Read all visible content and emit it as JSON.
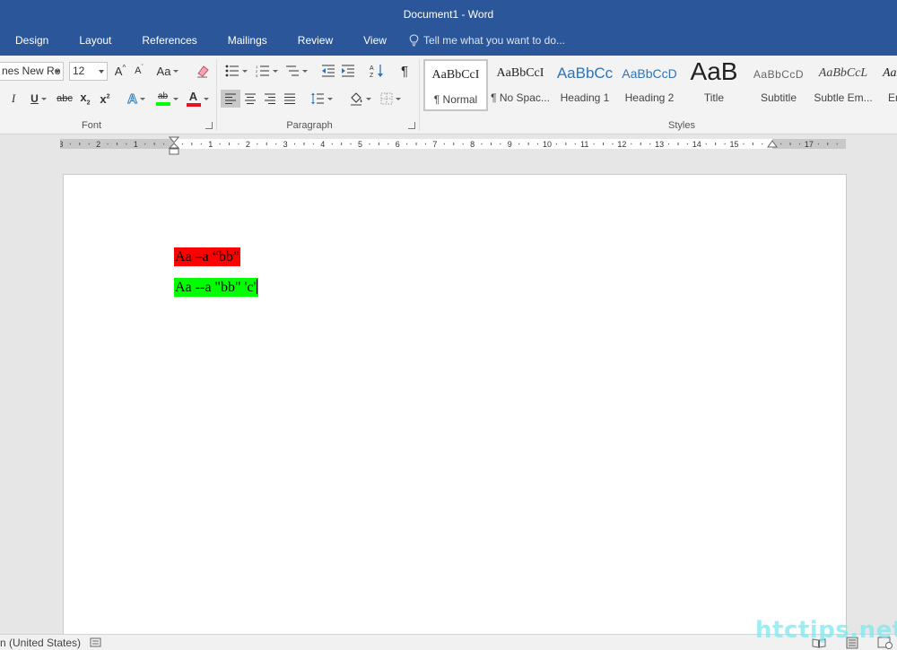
{
  "window": {
    "title": "Document1 - Word"
  },
  "tabs": [
    "Design",
    "Layout",
    "References",
    "Mailings",
    "Review",
    "View"
  ],
  "tell_me": {
    "placeholder": "Tell me what you want to do..."
  },
  "ribbon": {
    "font": {
      "group_label": "Font",
      "font_name": "nes New Ro",
      "font_size": "12",
      "grow_label": "A",
      "shrink_label": "A",
      "change_case_label": "Aa",
      "italic_label": "I",
      "underline_label": "U",
      "strike_label": "abc",
      "subscript_label": "x",
      "subscript_sub": "2",
      "superscript_label": "x",
      "superscript_sup": "2",
      "effects_label": "A",
      "highlight_label": "ab",
      "highlight_color": "#00ff00",
      "font_color_label": "A",
      "font_color": "#e81123"
    },
    "paragraph": {
      "group_label": "Paragraph"
    },
    "styles": {
      "group_label": "Styles",
      "items": [
        {
          "preview": "AaBbCcI",
          "name": "¶ Normal"
        },
        {
          "preview": "AaBbCcI",
          "name": "¶ No Spac..."
        },
        {
          "preview": "AaBbCc",
          "name": "Heading 1"
        },
        {
          "preview": "AaBbCcD",
          "name": "Heading 2"
        },
        {
          "preview": "AaB",
          "name": "Title"
        },
        {
          "preview": "AaBbCcD",
          "name": "Subtitle"
        },
        {
          "preview": "AaBbCcL",
          "name": "Subtle Em..."
        },
        {
          "preview": "AaBbCcL",
          "name": "Em"
        }
      ]
    }
  },
  "ruler": {
    "labels": [
      "3",
      "2",
      "1",
      "1",
      "2",
      "3",
      "4",
      "5",
      "6",
      "7",
      "8",
      "9",
      "10",
      "11",
      "12",
      "13",
      "14",
      "15",
      "17"
    ]
  },
  "document": {
    "lines": [
      {
        "text": "Aa –a “bb”",
        "highlight": "#ff0000"
      },
      {
        "text": "Aa --a \"bb\" 'c'",
        "highlight": "#00ff00"
      }
    ]
  },
  "status": {
    "language": "n (United States)"
  },
  "watermark": "htctips.net"
}
